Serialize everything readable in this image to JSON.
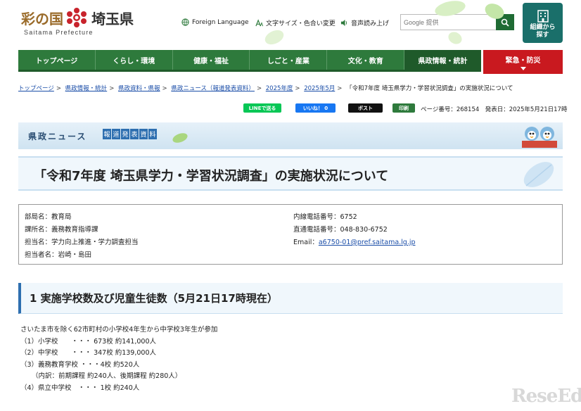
{
  "header": {
    "logo_text_1": "彩の国",
    "logo_text_2": "埼玉県",
    "logo_sub": "Saitama Prefecture",
    "util_language": "Foreign Language",
    "util_text_size": "文字サイズ・色合い変更",
    "util_voice": "音声読み上げ",
    "search_brand": "Google 提供",
    "org_button_line1": "組織から",
    "org_button_line2": "探す"
  },
  "nav": {
    "items": [
      "トップページ",
      "くらし・環境",
      "健康・福祉",
      "しごと・産業",
      "文化・教育",
      "県政情報・統計"
    ],
    "emergency": "緊急・防災"
  },
  "breadcrumb": {
    "items": [
      "トップページ",
      "県政情報・統計",
      "県政資料・県報",
      "県政ニュース（報道発表資料）",
      "2025年度",
      "2025年5月"
    ],
    "current": "「令和7年度 埼玉県学力・学習状況調査」の実施状況について"
  },
  "share": {
    "line": "LINEで送る",
    "facebook": "いいね！ 0",
    "x": "ポスト",
    "print": "印刷",
    "page_info": "ページ番号：268154　発表日：2025年5月21日17時"
  },
  "banner": {
    "title": "県政ニュース",
    "tag": [
      "報",
      "道",
      "発",
      "表",
      "資",
      "料"
    ]
  },
  "page_title": "「令和7年度 埼玉県学力・学習状況調査」の実施状況について",
  "info": {
    "department": "部局名：教育局",
    "division": "課所名：義務教育指導課",
    "section": "担当名：学力向上推進・学力調査担当",
    "person": "担当者名：岩崎・島田",
    "ext_phone": "内線電話番号：6752",
    "direct_phone": "直通電話番号：048-830-6752",
    "email_label": "Email：",
    "email": "a6750-01@pref.saitama.lg.jp"
  },
  "section1": {
    "heading": "1 実施学校数及び児童生徒数（5月21日17時現在）",
    "lines": [
      "さいたま市を除く62市町村の小学校4年生から中学校3年生が参加",
      "（1）小学校　　・・・ 673校  約141,000人",
      "（2）中学校　　・・・ 347校  約139,000人",
      "（3）義務教育学校 ・・・4校  約520人",
      "（内訳：前期課程 約240人、後期課程 約280人）",
      "（4）県立中学校　・・・ 1校  約240人"
    ]
  },
  "watermark": "ReseEd"
}
